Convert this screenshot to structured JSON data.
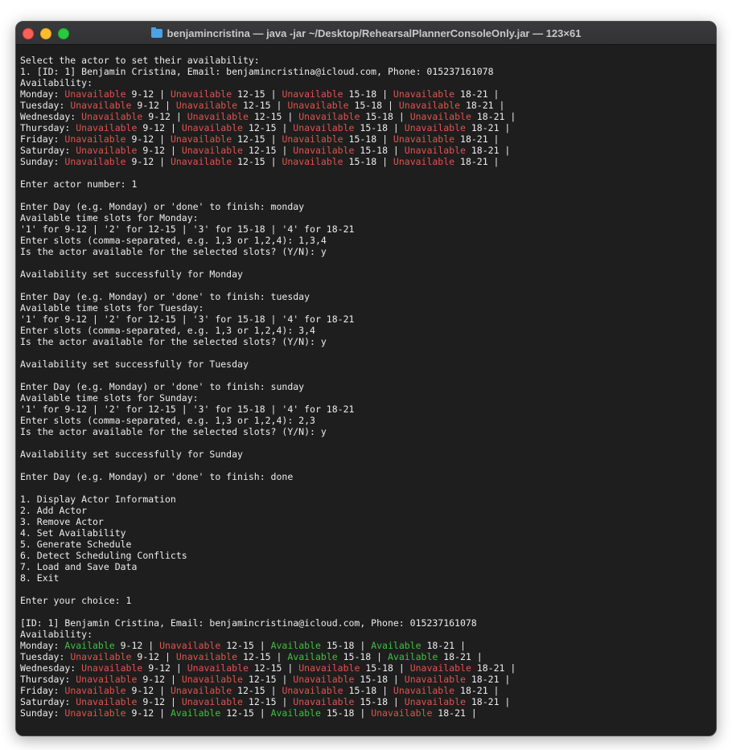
{
  "window": {
    "title": "benjamincristina — java -jar ~/Desktop/RehearsalPlannerConsoleOnly.jar — 123×61",
    "folder_icon": "folder-icon"
  },
  "colors": {
    "unavailable": "#e0544f",
    "available": "#3fc13f",
    "text": "#ededed",
    "background": "#1e1e1e"
  },
  "terminal": {
    "lines": [
      [
        {
          "t": "Select the actor to set their availability:"
        }
      ],
      [
        {
          "t": "1. [ID: 1] Benjamin Cristina, Email: benjamincristina@icloud.com, Phone: 015237161078"
        }
      ],
      [
        {
          "t": "Availability:"
        }
      ],
      [
        {
          "t": "Monday: "
        },
        {
          "t": "Unavailable",
          "c": "u"
        },
        {
          "t": " 9-12 | "
        },
        {
          "t": "Unavailable",
          "c": "u"
        },
        {
          "t": " 12-15 | "
        },
        {
          "t": "Unavailable",
          "c": "u"
        },
        {
          "t": " 15-18 | "
        },
        {
          "t": "Unavailable",
          "c": "u"
        },
        {
          "t": " 18-21 |"
        }
      ],
      [
        {
          "t": "Tuesday: "
        },
        {
          "t": "Unavailable",
          "c": "u"
        },
        {
          "t": " 9-12 | "
        },
        {
          "t": "Unavailable",
          "c": "u"
        },
        {
          "t": " 12-15 | "
        },
        {
          "t": "Unavailable",
          "c": "u"
        },
        {
          "t": " 15-18 | "
        },
        {
          "t": "Unavailable",
          "c": "u"
        },
        {
          "t": " 18-21 |"
        }
      ],
      [
        {
          "t": "Wednesday: "
        },
        {
          "t": "Unavailable",
          "c": "u"
        },
        {
          "t": " 9-12 | "
        },
        {
          "t": "Unavailable",
          "c": "u"
        },
        {
          "t": " 12-15 | "
        },
        {
          "t": "Unavailable",
          "c": "u"
        },
        {
          "t": " 15-18 | "
        },
        {
          "t": "Unavailable",
          "c": "u"
        },
        {
          "t": " 18-21 |"
        }
      ],
      [
        {
          "t": "Thursday: "
        },
        {
          "t": "Unavailable",
          "c": "u"
        },
        {
          "t": " 9-12 | "
        },
        {
          "t": "Unavailable",
          "c": "u"
        },
        {
          "t": " 12-15 | "
        },
        {
          "t": "Unavailable",
          "c": "u"
        },
        {
          "t": " 15-18 | "
        },
        {
          "t": "Unavailable",
          "c": "u"
        },
        {
          "t": " 18-21 |"
        }
      ],
      [
        {
          "t": "Friday: "
        },
        {
          "t": "Unavailable",
          "c": "u"
        },
        {
          "t": " 9-12 | "
        },
        {
          "t": "Unavailable",
          "c": "u"
        },
        {
          "t": " 12-15 | "
        },
        {
          "t": "Unavailable",
          "c": "u"
        },
        {
          "t": " 15-18 | "
        },
        {
          "t": "Unavailable",
          "c": "u"
        },
        {
          "t": " 18-21 |"
        }
      ],
      [
        {
          "t": "Saturday: "
        },
        {
          "t": "Unavailable",
          "c": "u"
        },
        {
          "t": " 9-12 | "
        },
        {
          "t": "Unavailable",
          "c": "u"
        },
        {
          "t": " 12-15 | "
        },
        {
          "t": "Unavailable",
          "c": "u"
        },
        {
          "t": " 15-18 | "
        },
        {
          "t": "Unavailable",
          "c": "u"
        },
        {
          "t": " 18-21 |"
        }
      ],
      [
        {
          "t": "Sunday: "
        },
        {
          "t": "Unavailable",
          "c": "u"
        },
        {
          "t": " 9-12 | "
        },
        {
          "t": "Unavailable",
          "c": "u"
        },
        {
          "t": " 12-15 | "
        },
        {
          "t": "Unavailable",
          "c": "u"
        },
        {
          "t": " 15-18 | "
        },
        {
          "t": "Unavailable",
          "c": "u"
        },
        {
          "t": " 18-21 |"
        }
      ],
      [],
      [
        {
          "t": "Enter actor number: 1"
        }
      ],
      [],
      [
        {
          "t": "Enter Day (e.g. Monday) or 'done' to finish: monday"
        }
      ],
      [
        {
          "t": "Available time slots for Monday:"
        }
      ],
      [
        {
          "t": "'1' for 9-12 | '2' for 12-15 | '3' for 15-18 | '4' for 18-21"
        }
      ],
      [
        {
          "t": "Enter slots (comma-separated, e.g. 1,3 or 1,2,4): 1,3,4"
        }
      ],
      [
        {
          "t": "Is the actor available for the selected slots? (Y/N): y"
        }
      ],
      [],
      [
        {
          "t": "Availability set successfully for Monday"
        }
      ],
      [],
      [
        {
          "t": "Enter Day (e.g. Monday) or 'done' to finish: tuesday"
        }
      ],
      [
        {
          "t": "Available time slots for Tuesday:"
        }
      ],
      [
        {
          "t": "'1' for 9-12 | '2' for 12-15 | '3' for 15-18 | '4' for 18-21"
        }
      ],
      [
        {
          "t": "Enter slots (comma-separated, e.g. 1,3 or 1,2,4): 3,4"
        }
      ],
      [
        {
          "t": "Is the actor available for the selected slots? (Y/N): y"
        }
      ],
      [],
      [
        {
          "t": "Availability set successfully for Tuesday"
        }
      ],
      [],
      [
        {
          "t": "Enter Day (e.g. Monday) or 'done' to finish: sunday"
        }
      ],
      [
        {
          "t": "Available time slots for Sunday:"
        }
      ],
      [
        {
          "t": "'1' for 9-12 | '2' for 12-15 | '3' for 15-18 | '4' for 18-21"
        }
      ],
      [
        {
          "t": "Enter slots (comma-separated, e.g. 1,3 or 1,2,4): 2,3"
        }
      ],
      [
        {
          "t": "Is the actor available for the selected slots? (Y/N): y"
        }
      ],
      [],
      [
        {
          "t": "Availability set successfully for Sunday"
        }
      ],
      [],
      [
        {
          "t": "Enter Day (e.g. Monday) or 'done' to finish: done"
        }
      ],
      [],
      [
        {
          "t": "1. Display Actor Information"
        }
      ],
      [
        {
          "t": "2. Add Actor"
        }
      ],
      [
        {
          "t": "3. Remove Actor"
        }
      ],
      [
        {
          "t": "4. Set Availability"
        }
      ],
      [
        {
          "t": "5. Generate Schedule"
        }
      ],
      [
        {
          "t": "6. Detect Scheduling Conflicts"
        }
      ],
      [
        {
          "t": "7. Load and Save Data"
        }
      ],
      [
        {
          "t": "8. Exit"
        }
      ],
      [],
      [
        {
          "t": "Enter your choice: 1"
        }
      ],
      [],
      [
        {
          "t": "[ID: 1] Benjamin Cristina, Email: benjamincristina@icloud.com, Phone: 015237161078"
        }
      ],
      [
        {
          "t": "Availability:"
        }
      ],
      [
        {
          "t": "Monday: "
        },
        {
          "t": "Available",
          "c": "a"
        },
        {
          "t": " 9-12 | "
        },
        {
          "t": "Unavailable",
          "c": "u"
        },
        {
          "t": " 12-15 | "
        },
        {
          "t": "Available",
          "c": "a"
        },
        {
          "t": " 15-18 | "
        },
        {
          "t": "Available",
          "c": "a"
        },
        {
          "t": " 18-21 |"
        }
      ],
      [
        {
          "t": "Tuesday: "
        },
        {
          "t": "Unavailable",
          "c": "u"
        },
        {
          "t": " 9-12 | "
        },
        {
          "t": "Unavailable",
          "c": "u"
        },
        {
          "t": " 12-15 | "
        },
        {
          "t": "Available",
          "c": "a"
        },
        {
          "t": " 15-18 | "
        },
        {
          "t": "Available",
          "c": "a"
        },
        {
          "t": " 18-21 |"
        }
      ],
      [
        {
          "t": "Wednesday: "
        },
        {
          "t": "Unavailable",
          "c": "u"
        },
        {
          "t": " 9-12 | "
        },
        {
          "t": "Unavailable",
          "c": "u"
        },
        {
          "t": " 12-15 | "
        },
        {
          "t": "Unavailable",
          "c": "u"
        },
        {
          "t": " 15-18 | "
        },
        {
          "t": "Unavailable",
          "c": "u"
        },
        {
          "t": " 18-21 |"
        }
      ],
      [
        {
          "t": "Thursday: "
        },
        {
          "t": "Unavailable",
          "c": "u"
        },
        {
          "t": " 9-12 | "
        },
        {
          "t": "Unavailable",
          "c": "u"
        },
        {
          "t": " 12-15 | "
        },
        {
          "t": "Unavailable",
          "c": "u"
        },
        {
          "t": " 15-18 | "
        },
        {
          "t": "Unavailable",
          "c": "u"
        },
        {
          "t": " 18-21 |"
        }
      ],
      [
        {
          "t": "Friday: "
        },
        {
          "t": "Unavailable",
          "c": "u"
        },
        {
          "t": " 9-12 | "
        },
        {
          "t": "Unavailable",
          "c": "u"
        },
        {
          "t": " 12-15 | "
        },
        {
          "t": "Unavailable",
          "c": "u"
        },
        {
          "t": " 15-18 | "
        },
        {
          "t": "Unavailable",
          "c": "u"
        },
        {
          "t": " 18-21 |"
        }
      ],
      [
        {
          "t": "Saturday: "
        },
        {
          "t": "Unavailable",
          "c": "u"
        },
        {
          "t": " 9-12 | "
        },
        {
          "t": "Unavailable",
          "c": "u"
        },
        {
          "t": " 12-15 | "
        },
        {
          "t": "Unavailable",
          "c": "u"
        },
        {
          "t": " 15-18 | "
        },
        {
          "t": "Unavailable",
          "c": "u"
        },
        {
          "t": " 18-21 |"
        }
      ],
      [
        {
          "t": "Sunday: "
        },
        {
          "t": "Unavailable",
          "c": "u"
        },
        {
          "t": " 9-12 | "
        },
        {
          "t": "Available",
          "c": "a"
        },
        {
          "t": " 12-15 | "
        },
        {
          "t": "Available",
          "c": "a"
        },
        {
          "t": " 15-18 | "
        },
        {
          "t": "Unavailable",
          "c": "u"
        },
        {
          "t": " 18-21 |"
        }
      ]
    ]
  }
}
